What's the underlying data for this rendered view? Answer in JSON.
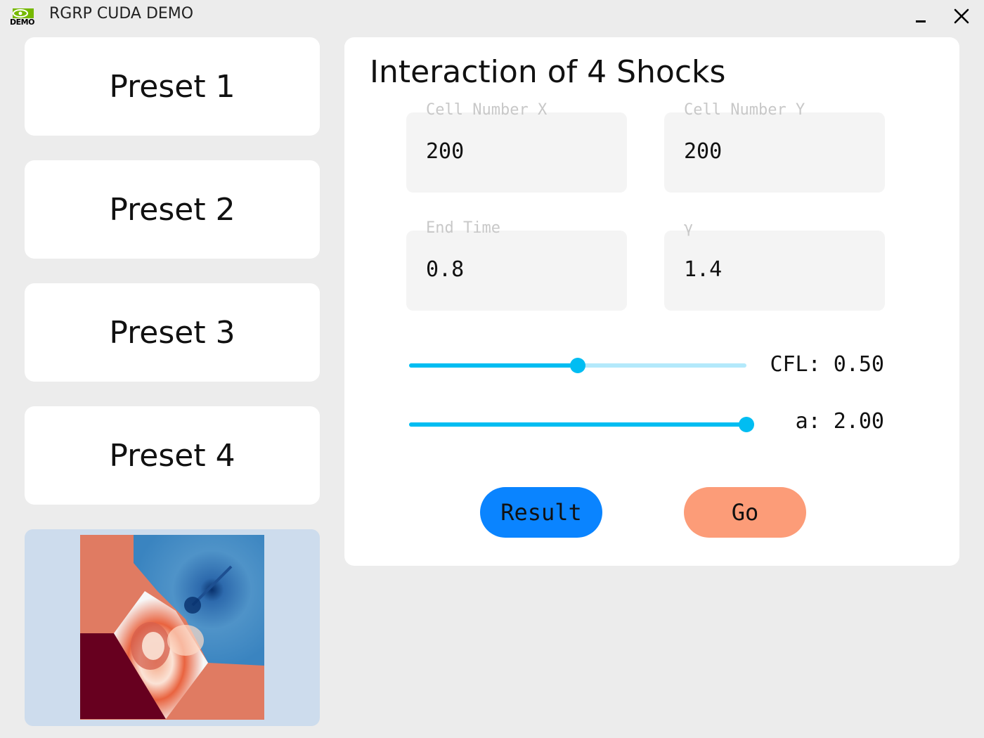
{
  "window": {
    "logo_label": "DEMO",
    "title": "RGRP CUDA DEMO"
  },
  "presets": [
    {
      "label": "Preset 1"
    },
    {
      "label": "Preset 2"
    },
    {
      "label": "Preset 3"
    },
    {
      "label": "Preset 4"
    }
  ],
  "panel": {
    "title": "Interaction of 4 Shocks",
    "fields": [
      {
        "label": "Cell Number X",
        "value": "200"
      },
      {
        "label": "Cell Number Y",
        "value": "200"
      },
      {
        "label": "End Time",
        "value": "0.8"
      },
      {
        "label": "γ",
        "value": "1.4"
      }
    ],
    "sliders": [
      {
        "display": "CFL: 0.50",
        "fraction": 0.5
      },
      {
        "display": "a: 2.00",
        "fraction": 1.0
      }
    ],
    "buttons": {
      "result_label": "Result",
      "go_label": "Go"
    }
  },
  "colors": {
    "result_button": "#0a84ff",
    "go_button": "#fc9c78",
    "slider_active": "#00bdf2",
    "slider_inactive": "#b3e9fb",
    "preview_background": "#cddced"
  }
}
